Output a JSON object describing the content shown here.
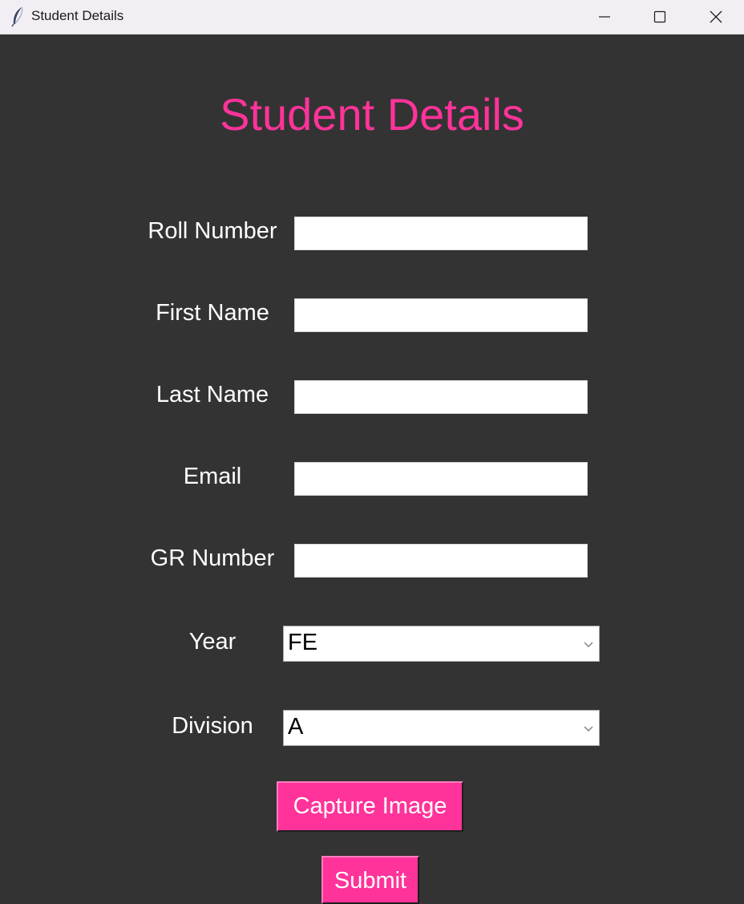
{
  "window": {
    "title": "Student Details"
  },
  "form": {
    "heading": "Student Details",
    "fields": [
      {
        "label": "Roll Number",
        "value": ""
      },
      {
        "label": "First Name",
        "value": ""
      },
      {
        "label": "Last Name",
        "value": ""
      },
      {
        "label": "Email",
        "value": ""
      },
      {
        "label": "GR Number",
        "value": ""
      }
    ],
    "year": {
      "label": "Year",
      "selected": "FE"
    },
    "division": {
      "label": "Division",
      "selected": "A"
    },
    "capture_button": "Capture Image",
    "submit_button": "Submit"
  },
  "colors": {
    "background": "#333333",
    "accent": "#ff3399",
    "label_text": "#ffffff",
    "titlebar": "#f3eef4"
  },
  "icons": {
    "app": "feather-icon",
    "minimize": "minimize-icon",
    "maximize": "maximize-icon",
    "close": "close-icon",
    "dropdown": "chevron-down-icon"
  }
}
